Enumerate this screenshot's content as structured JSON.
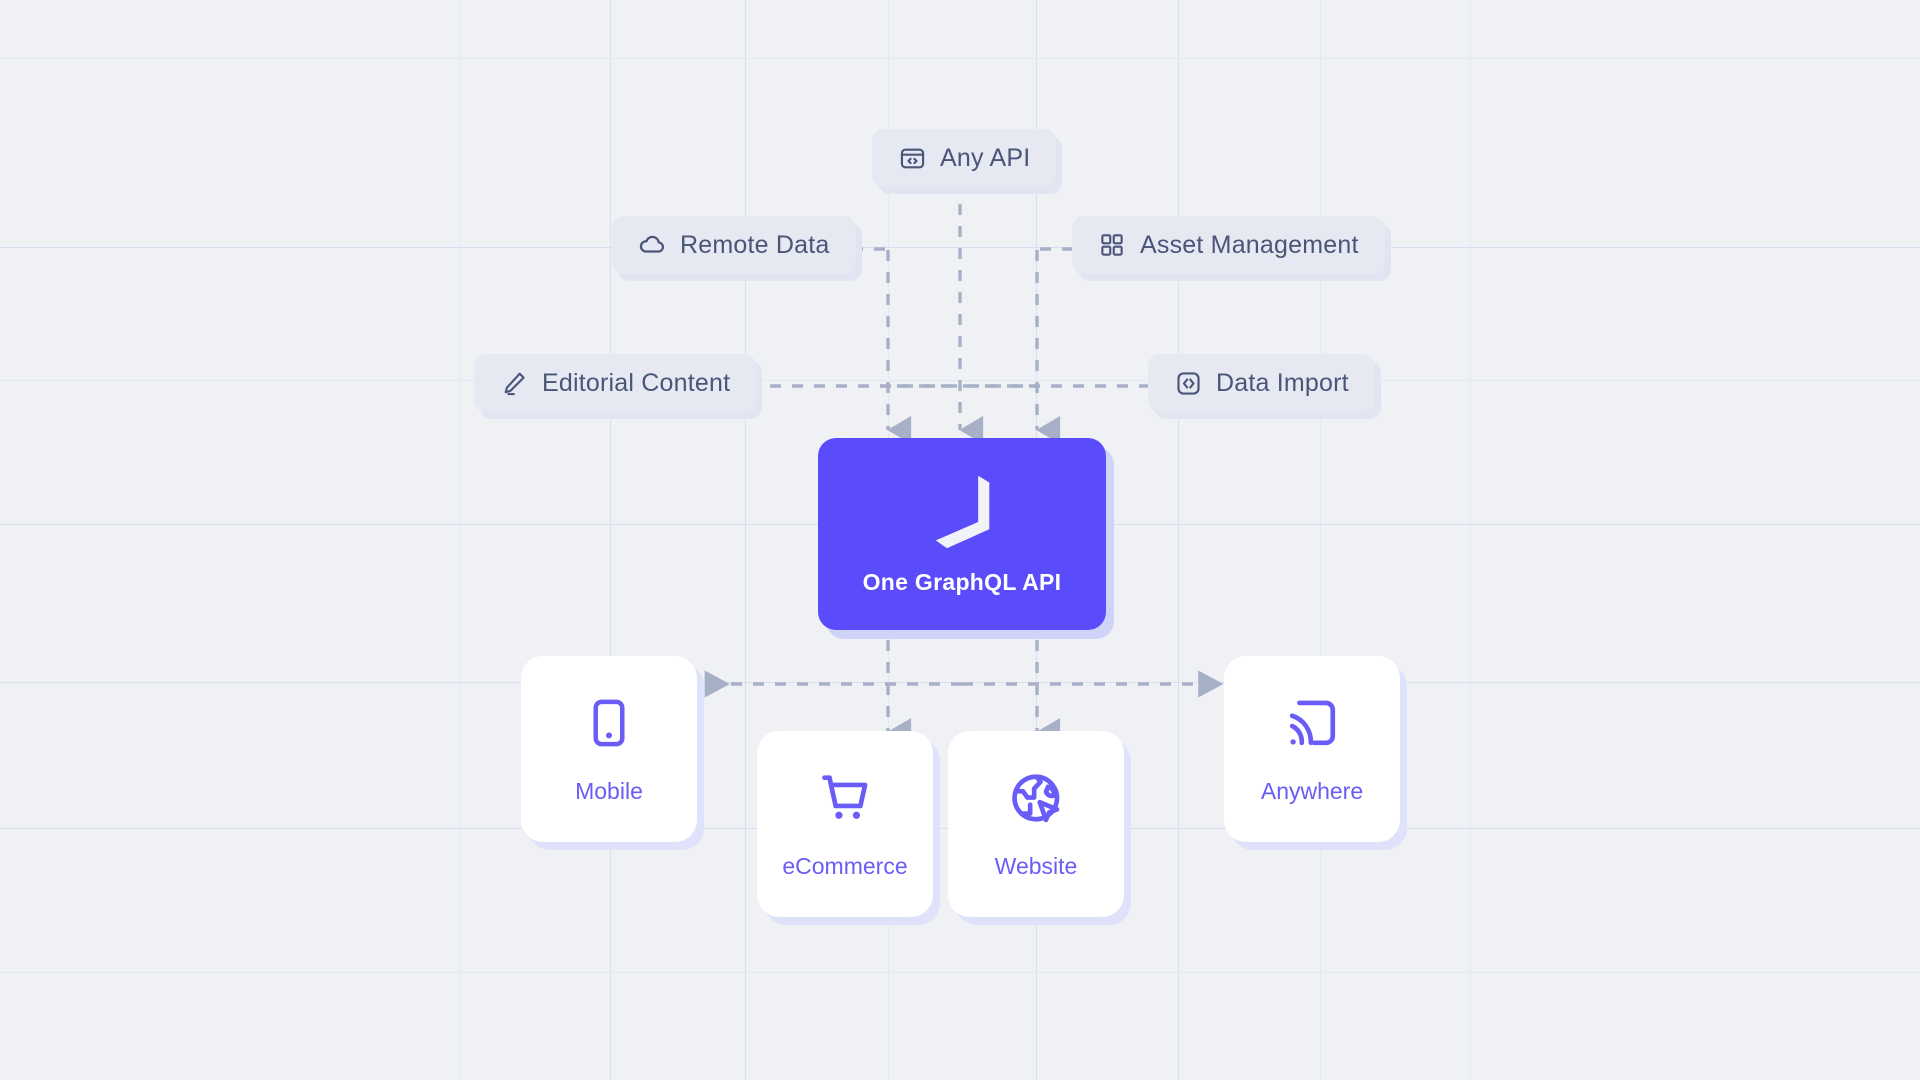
{
  "diagram": {
    "title": "One GraphQL API content federation diagram",
    "colors": {
      "background": "#eff1f5",
      "grid_line": "#d9def0",
      "pill_background": "#e6e9f2",
      "pill_text": "#4a5578",
      "accent_purple": "#5a4cfa",
      "output_label": "#6a5cf7",
      "card_background": "#ffffff",
      "connector": "#a8b0c8"
    },
    "inputs": [
      {
        "id": "any-api",
        "label": "Any API",
        "icon": "browser-code-icon"
      },
      {
        "id": "remote-data",
        "label": "Remote Data",
        "icon": "cloud-icon"
      },
      {
        "id": "asset-management",
        "label": "Asset Management",
        "icon": "grid-squares-icon"
      },
      {
        "id": "editorial-content",
        "label": "Editorial Content",
        "icon": "pencil-edit-icon"
      },
      {
        "id": "data-import",
        "label": "Data Import",
        "icon": "code-brackets-box-icon"
      }
    ],
    "hub": {
      "label": "One GraphQL API",
      "icon": "hygraph-logo-icon"
    },
    "outputs": [
      {
        "id": "mobile",
        "label": "Mobile",
        "icon": "smartphone-icon"
      },
      {
        "id": "ecommerce",
        "label": "eCommerce",
        "icon": "shopping-cart-icon"
      },
      {
        "id": "website",
        "label": "Website",
        "icon": "globe-cursor-icon"
      },
      {
        "id": "anywhere",
        "label": "Anywhere",
        "icon": "screencast-icon"
      }
    ]
  }
}
